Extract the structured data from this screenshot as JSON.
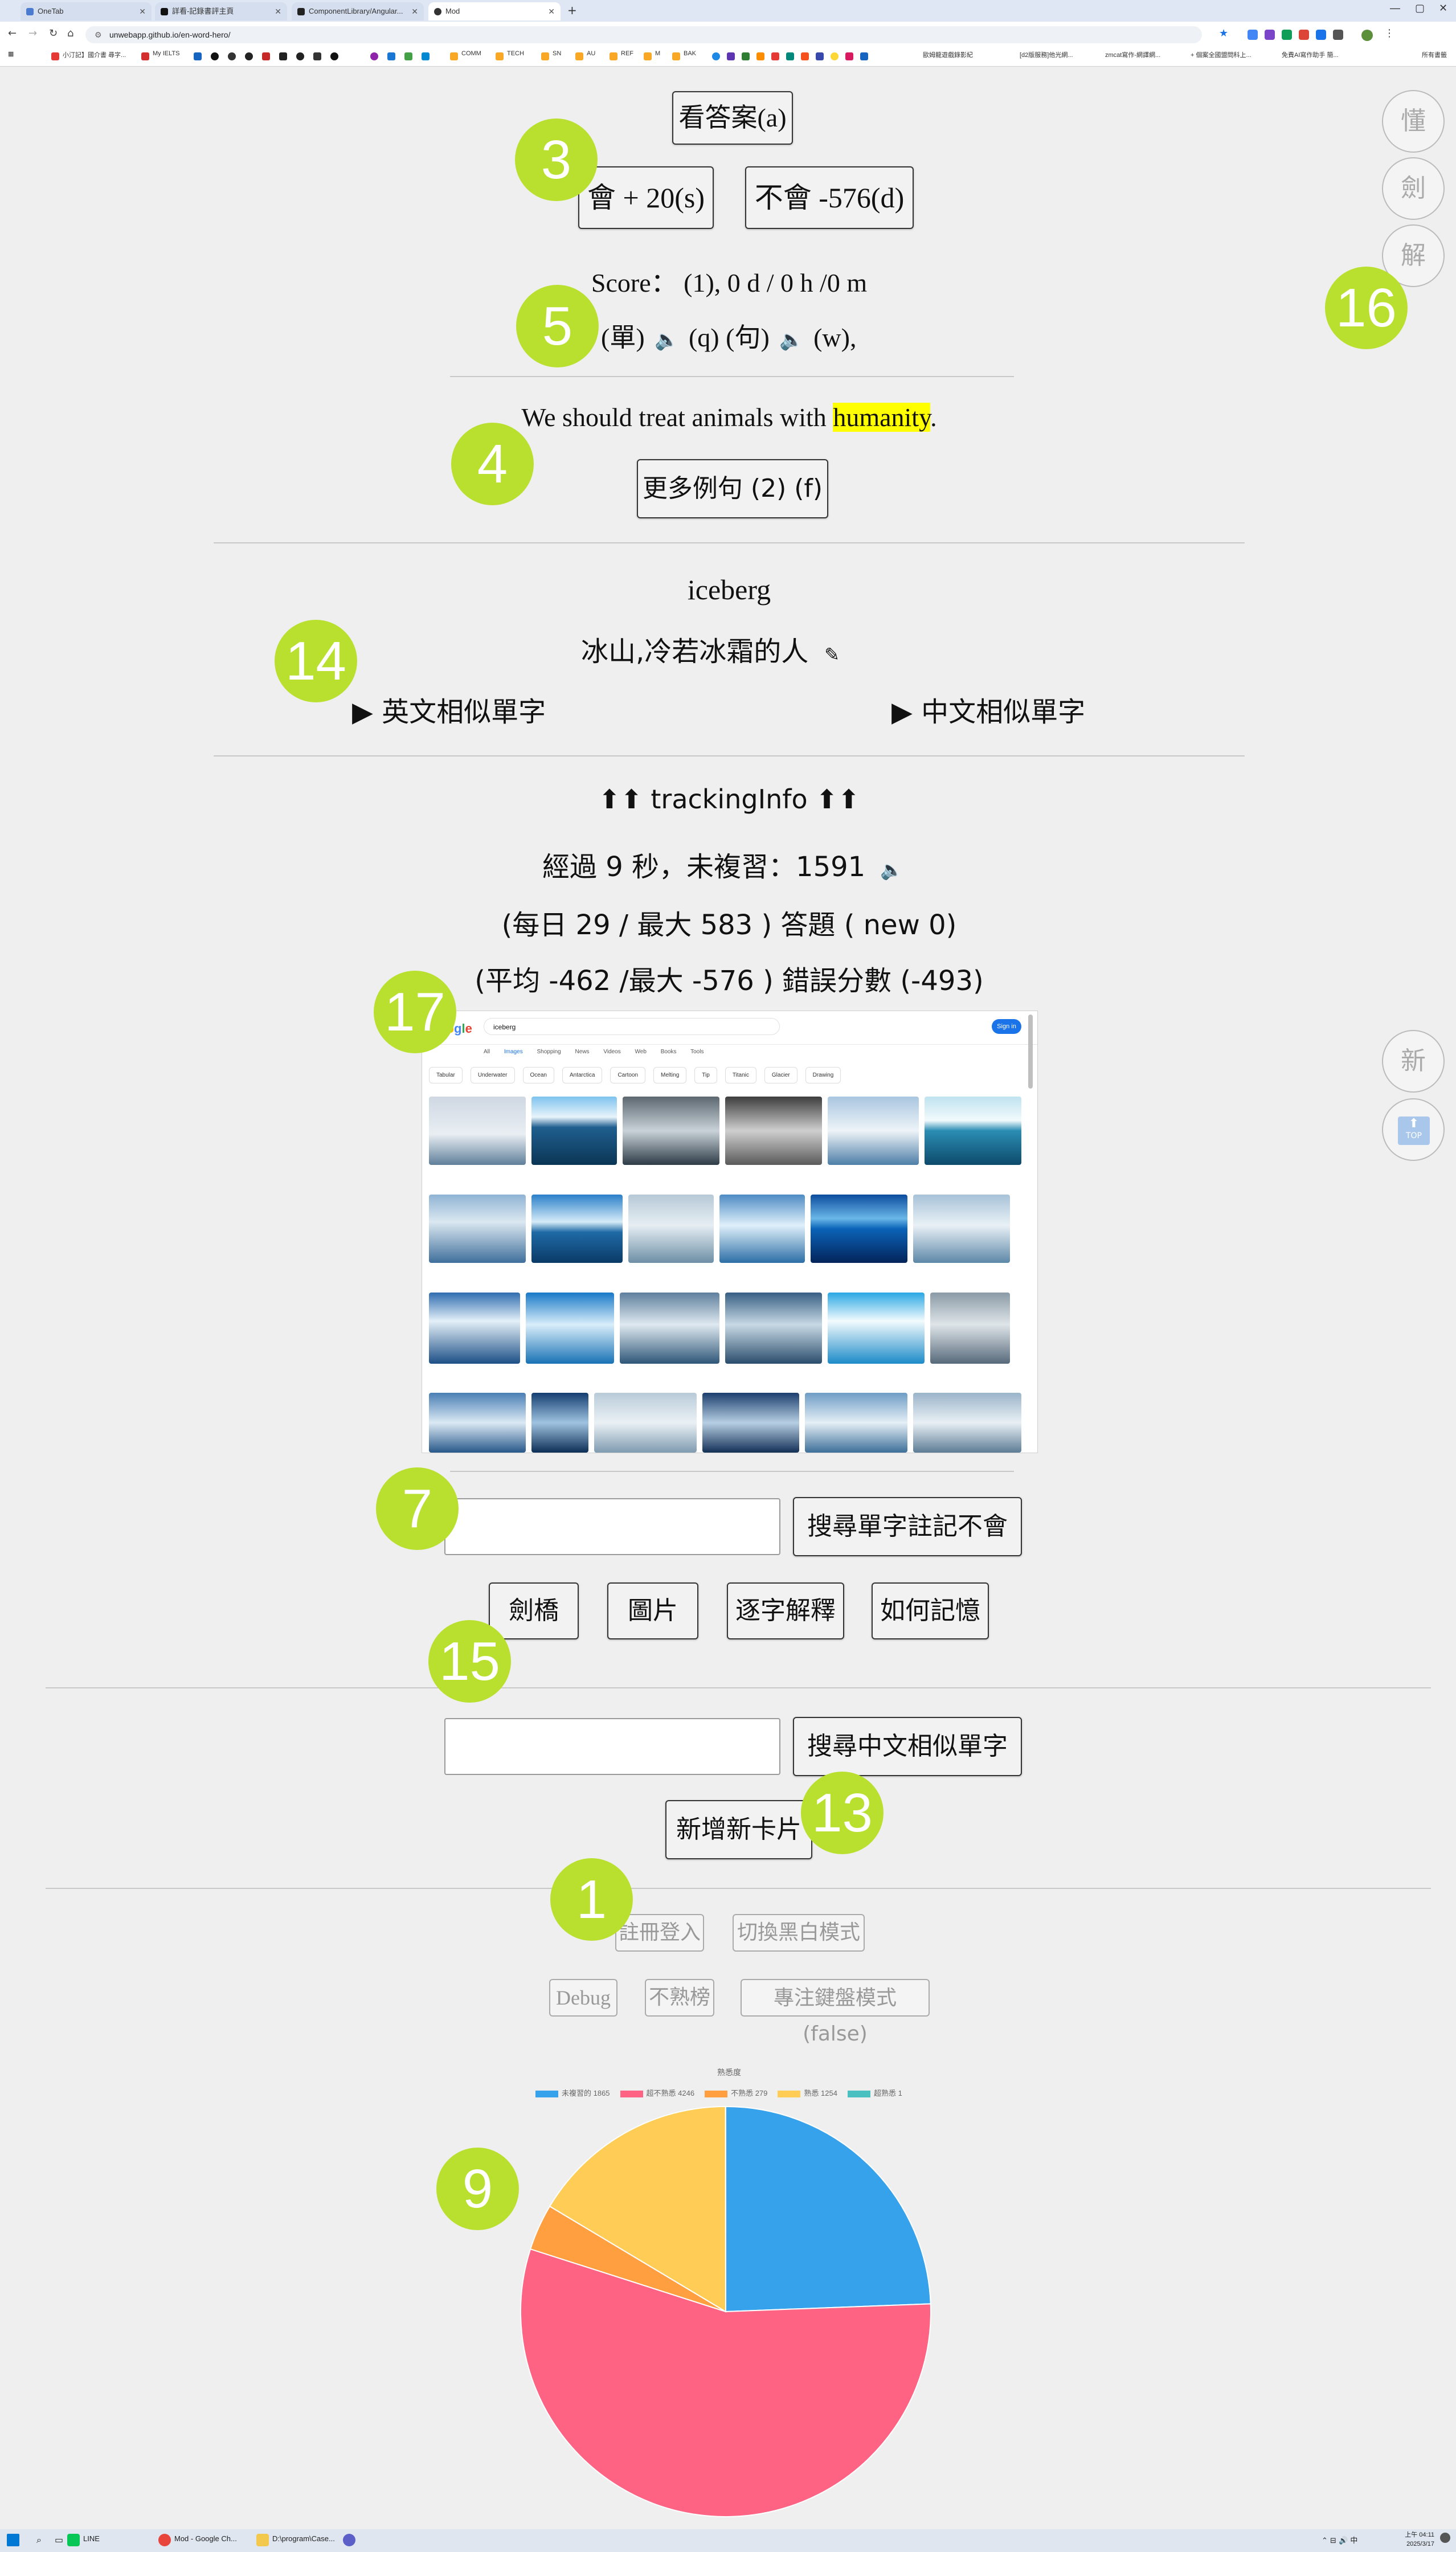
{
  "browser": {
    "tabs": [
      {
        "label": "OneTab"
      },
      {
        "label": "詳看-記錄書評主頁"
      },
      {
        "label": "ComponentLibrary/Angular..."
      },
      {
        "label": "Mod"
      }
    ],
    "url": "unwebapp.github.io/en-word-hero/",
    "bookmarks": [
      "小汀記】國介書 尋字...",
      "My IELTS",
      "COMM",
      "TECH",
      "SN",
      "AU",
      "REF",
      "M",
      "BAK",
      "歐姆龍遊戲錄影紀",
      "[d2版服務]他光網...",
      "zmcat寫作-網譯網...",
      "+ 個案全國盟問科上...",
      "免費AI寫作助手 簡...",
      "所有書籤"
    ]
  },
  "quiz": {
    "show_answer": "看答案(a)",
    "know": "會 + 20(s)",
    "dont_know": "不會 -576(d)",
    "score": "Score： (1), 0 d / 0 h /0 m",
    "audio_word": "(單)",
    "audio_word_key": "(q)",
    "audio_sentence": "(句)",
    "audio_sentence_key": "(w),"
  },
  "example": {
    "before": "We should treat animals with ",
    "word": "humanity",
    "after": ".",
    "more": "更多例句 (2) (f)"
  },
  "card": {
    "word": "iceberg",
    "meaning": "冰山,冷若冰霜的人",
    "en_similar": "▶ 英文相似單字",
    "zh_similar": "▶ 中文相似單字"
  },
  "tracking": {
    "title": "⬆⬆ trackingInfo ⬆⬆",
    "elapsed": "經過 9 秒，未複習：1591",
    "daily": "(每日 29 / 最大 583 ) 答題 ( new 0)",
    "avg": "(平均 -462 /最大 -576 ) 錯誤分數 (-493)"
  },
  "google": {
    "query": "iceberg",
    "tabs": [
      "All",
      "Images",
      "Shopping",
      "News",
      "Videos",
      "Web",
      "Books",
      "Tools"
    ],
    "chips": [
      "Tabular",
      "Underwater",
      "Ocean",
      "Antarctica",
      "Cartoon",
      "Melting",
      "Tip",
      "Titanic",
      "Glacier",
      "Drawing"
    ],
    "sign_in": "Sign in"
  },
  "search": {
    "search_note_btn": "搜尋單字註記不會",
    "links": [
      "劍橋",
      "圖片",
      "逐字解釋",
      "如何記憶"
    ],
    "search_zh_btn": "搜尋中文相似單字",
    "add_card": "新增新卡片"
  },
  "settings": {
    "register": "註冊登入",
    "theme": "切換黑白模式",
    "debug": "Debug",
    "unfamiliar": "不熟榜",
    "focus": "專注鍵盤模式 (false)"
  },
  "chart_data": {
    "type": "pie",
    "title": "熟悉度",
    "series": [
      {
        "name": "未複習的 1865",
        "value": 1865,
        "color": "#36a2eb"
      },
      {
        "name": "超不熟悉 4246",
        "value": 4246,
        "color": "#ff6384"
      },
      {
        "name": "不熟悉 279",
        "value": 279,
        "color": "#ff9f40"
      },
      {
        "name": "熟悉 1254",
        "value": 1254,
        "color": "#ffcd56"
      },
      {
        "name": "超熟悉 1",
        "value": 1,
        "color": "#4bc0c0"
      }
    ]
  },
  "side": {
    "dong": "懂",
    "jian": "劍",
    "jie": "解",
    "xin": "新",
    "top": "TOP"
  },
  "badges": {
    "b3": "3",
    "b5": "5",
    "b4": "4",
    "b14": "14",
    "b16": "16",
    "b17": "17",
    "b7": "7",
    "b15": "15",
    "b13": "13",
    "b1": "1",
    "b9": "9"
  },
  "taskbar": {
    "apps": [
      "LINE",
      "Mod - Google Ch...",
      "D:\\program\\Case..."
    ],
    "time": "上午 04:11",
    "date": "2025/3/17"
  }
}
